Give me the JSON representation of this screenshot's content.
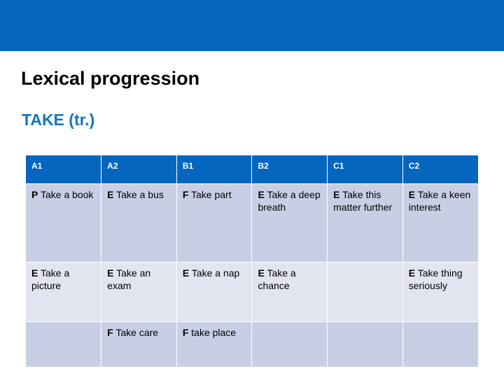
{
  "slide": {
    "title": "Lexical progression",
    "subtitle": "TAKE (tr.)",
    "band_color": "#0566bf",
    "subtitle_color": "#1775c0",
    "header_text_color": "#ffffff",
    "row_shade_dark": "#c8cfe5",
    "row_shade_light": "#e2e5f0"
  },
  "table": {
    "columns": [
      "A1",
      "A2",
      "B1",
      "B2",
      "C1",
      "C2"
    ],
    "rows": [
      [
        {
          "code": "P",
          "text": "Take a book"
        },
        {
          "code": "E",
          "text": "Take a bus"
        },
        {
          "code": "F",
          "text": "Take part"
        },
        {
          "code": "E",
          "text": "Take a deep breath"
        },
        {
          "code": "E",
          "text": "Take this matter further"
        },
        {
          "code": "E",
          "text": "Take a keen interest"
        }
      ],
      [
        {
          "code": "E",
          "text": "Take a picture"
        },
        {
          "code": "E",
          "text": "Take an exam"
        },
        {
          "code": "E",
          "text": "Take a nap"
        },
        {
          "code": "E",
          "text": "Take a chance"
        },
        {
          "code": "",
          "text": ""
        },
        {
          "code": "E",
          "text": "Take thing seriously"
        }
      ],
      [
        {
          "code": "",
          "text": ""
        },
        {
          "code": "F",
          "text": "Take care"
        },
        {
          "code": "F",
          "text": "take place"
        },
        {
          "code": "",
          "text": ""
        },
        {
          "code": "",
          "text": ""
        },
        {
          "code": "",
          "text": ""
        }
      ]
    ]
  }
}
